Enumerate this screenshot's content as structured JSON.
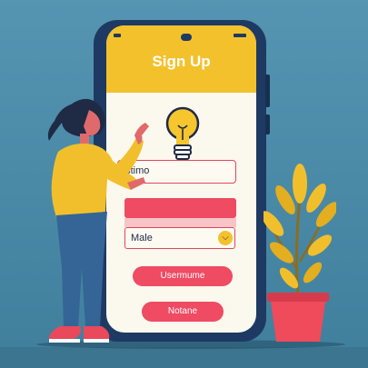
{
  "screen": {
    "title": "Sign Up",
    "name_field_value": "ustimo",
    "gender_select_value": "Male",
    "button_primary_label": "Usermume",
    "button_secondary_label": "Notane"
  },
  "icons": {
    "idea": "lightbulb-icon",
    "select_arrow": "chevron-down-icon"
  },
  "colors": {
    "background": "#4a8aa8",
    "phone_body": "#1e3a63",
    "accent_yellow": "#f3c12c",
    "accent_red": "#ef4b63"
  }
}
